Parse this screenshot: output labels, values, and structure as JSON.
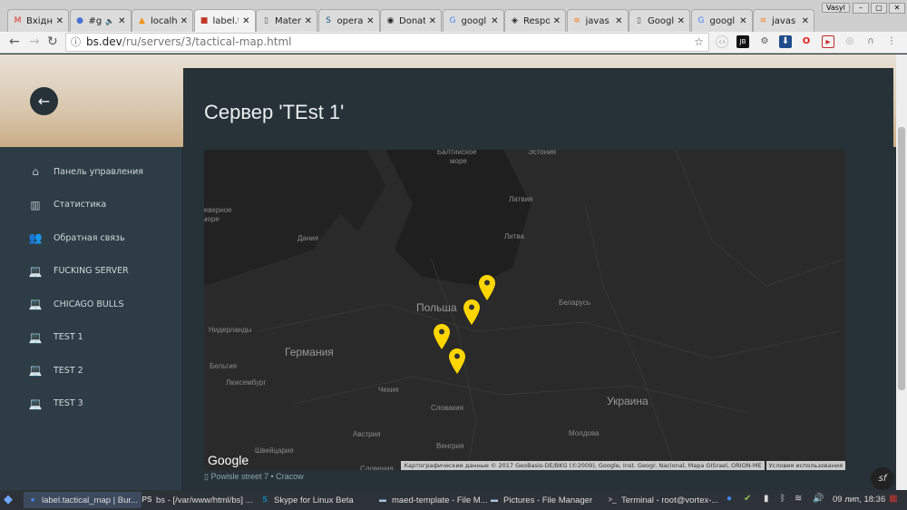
{
  "browser": {
    "tabs": [
      {
        "label": "Вхідні",
        "icon": "gmail-icon",
        "color": "#d93025",
        "glyph": "M"
      },
      {
        "label": "#g",
        "icon": "chat-icon",
        "color": "#4a6fd6",
        "glyph": "●",
        "muted": "🔈"
      },
      {
        "label": "localh",
        "icon": "pma-icon",
        "color": "#f29111",
        "glyph": "▲"
      },
      {
        "label": "label.t",
        "icon": "site-icon",
        "color": "#c0392b",
        "glyph": "■",
        "active": true
      },
      {
        "label": "Mater",
        "icon": "document-icon",
        "color": "#555",
        "glyph": "▯"
      },
      {
        "label": "opera",
        "icon": "bs-icon",
        "color": "#1a4e8a",
        "glyph": "S"
      },
      {
        "label": "Donat",
        "icon": "donate-icon",
        "color": "#222",
        "glyph": "◉"
      },
      {
        "label": "googl",
        "icon": "google-icon",
        "color": "#4285f4",
        "glyph": "G"
      },
      {
        "label": "Respo",
        "icon": "codepen-icon",
        "color": "#222",
        "glyph": "◈"
      },
      {
        "label": "javas",
        "icon": "stackoverflow-icon",
        "color": "#f48024",
        "glyph": "≡"
      },
      {
        "label": "Googl",
        "icon": "document-icon",
        "color": "#555",
        "glyph": "▯"
      },
      {
        "label": "googl",
        "icon": "google-icon",
        "color": "#4285f4",
        "glyph": "G"
      },
      {
        "label": "javas",
        "icon": "stackoverflow-icon",
        "color": "#f48024",
        "glyph": "≡"
      }
    ],
    "close_glyph": "✕",
    "user": "Vasyl",
    "url_host": "bs.dev",
    "url_path": "/ru/servers/3/tactical-map.html"
  },
  "page": {
    "title": "Сервер 'TEst 1'",
    "sidebar": [
      {
        "label": "Панель управления",
        "icon": "home-icon",
        "glyph": "⌂"
      },
      {
        "label": "Статистика",
        "icon": "chart-icon",
        "glyph": "▥"
      },
      {
        "label": "Обратная связь",
        "icon": "people-icon",
        "glyph": "👥"
      },
      {
        "label": "FUCKING SERVER",
        "icon": "laptop-icon",
        "glyph": "💻"
      },
      {
        "label": "CHICAGO BULLS",
        "icon": "laptop-icon",
        "glyph": "💻"
      },
      {
        "label": "TEST 1",
        "icon": "laptop-icon",
        "glyph": "💻"
      },
      {
        "label": "TEST 2",
        "icon": "laptop-icon",
        "glyph": "💻"
      },
      {
        "label": "TEST 3",
        "icon": "laptop-icon",
        "glyph": "💻"
      }
    ],
    "map": {
      "labels": [
        {
          "text": "Балтийское",
          "cls": ""
        },
        {
          "text": "море",
          "cls": ""
        },
        {
          "text": "Эстония",
          "cls": ""
        },
        {
          "text": "Северное",
          "cls": ""
        },
        {
          "text": "море",
          "cls": ""
        },
        {
          "text": "Латвия",
          "cls": ""
        },
        {
          "text": "Дания",
          "cls": ""
        },
        {
          "text": "Литва",
          "cls": ""
        },
        {
          "text": "Польша",
          "cls": "big"
        },
        {
          "text": "Беларусь",
          "cls": ""
        },
        {
          "text": "Нидерланды",
          "cls": ""
        },
        {
          "text": "Германия",
          "cls": "big"
        },
        {
          "text": "Бельгия",
          "cls": ""
        },
        {
          "text": "Люксембург",
          "cls": ""
        },
        {
          "text": "Чехия",
          "cls": ""
        },
        {
          "text": "Словакия",
          "cls": ""
        },
        {
          "text": "Украина",
          "cls": "big"
        },
        {
          "text": "Австрия",
          "cls": ""
        },
        {
          "text": "Молдова",
          "cls": ""
        },
        {
          "text": "Венгрия",
          "cls": ""
        },
        {
          "text": "Швейцария",
          "cls": ""
        },
        {
          "text": "Словения",
          "cls": ""
        }
      ],
      "marker_color": "#ffd600",
      "marker_count": 4,
      "logo": "Google",
      "attribution": "Картографические данные © 2017 GeoBasis-DE/BKG (©2009), Google, Inst. Geogr. Nacional, Mapa GISrael, ORION-ME",
      "terms": "Условия использования"
    },
    "address": "Powisle street 7 • Cracow"
  },
  "taskbar": {
    "items": [
      {
        "label": "label.tactical_map | Bur...",
        "icon": "chrome-icon",
        "active": true
      },
      {
        "label": "bs - [/var/www/html/bs] ...",
        "icon": "phpstorm-icon"
      },
      {
        "label": "Skype for Linux Beta",
        "icon": "skype-icon"
      },
      {
        "label": "maed-template - File M...",
        "icon": "folder-icon"
      },
      {
        "label": "Pictures - File Manager",
        "icon": "folder-icon"
      },
      {
        "label": "Terminal - root@vortex-...",
        "icon": "terminal-icon"
      }
    ],
    "clock": "09 лип, 18:36"
  }
}
